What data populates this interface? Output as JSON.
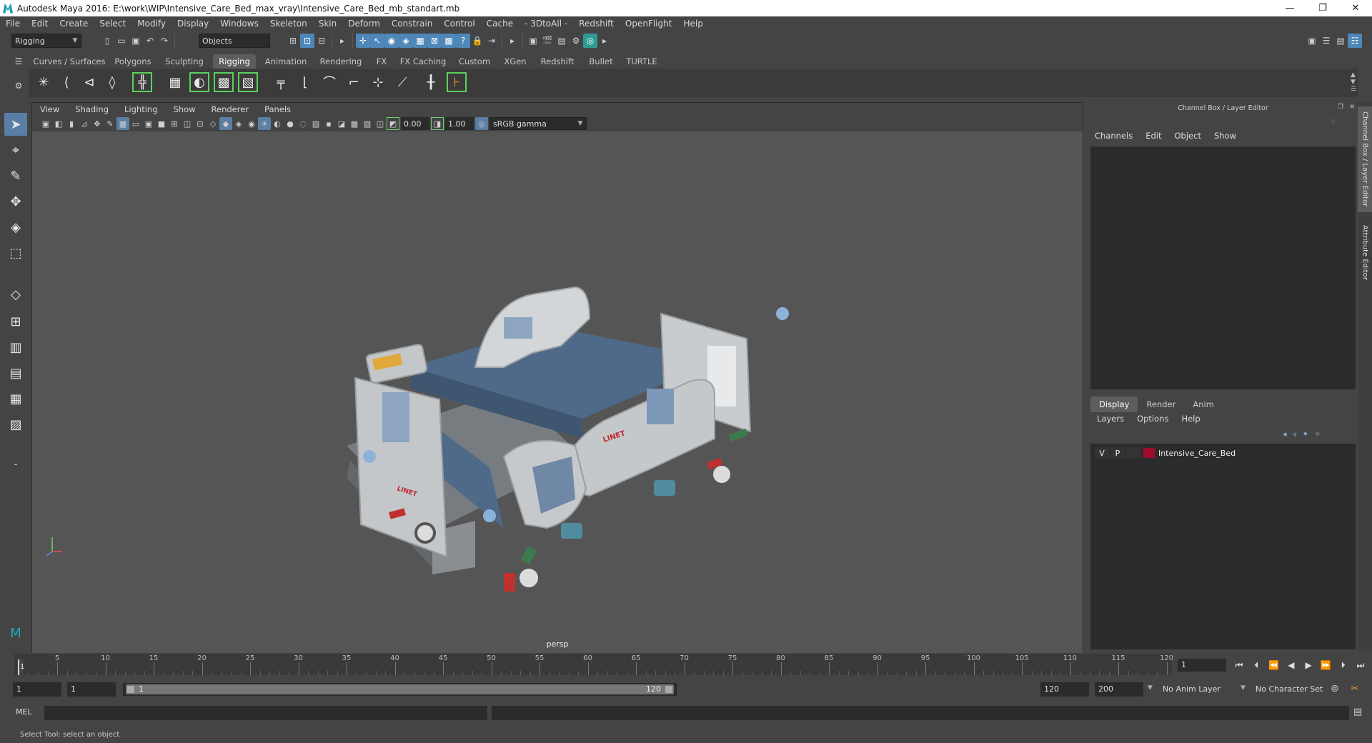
{
  "window": {
    "title": "Autodesk Maya 2016: E:\\work\\WIP\\Intensive_Care_Bed_max_vray\\Intensive_Care_Bed_mb_standart.mb",
    "minimize": "—",
    "restore": "❐",
    "close": "✕"
  },
  "menubar": {
    "items": [
      "File",
      "Edit",
      "Create",
      "Select",
      "Modify",
      "Display",
      "Windows",
      "Skeleton",
      "Skin",
      "Deform",
      "Constrain",
      "Control",
      "Cache",
      "- 3DtoAll -",
      "Redshift",
      "OpenFlight",
      "Help"
    ]
  },
  "statusline": {
    "menuset": "Rigging",
    "selection_mask": "Objects"
  },
  "shelf": {
    "tabs": [
      "Curves / Surfaces",
      "Polygons",
      "Sculpting",
      "Rigging",
      "Animation",
      "Rendering",
      "FX",
      "FX Caching",
      "Custom",
      "XGen",
      "Redshift",
      "Bullet",
      "TURTLE"
    ],
    "active_tab": "Rigging",
    "icons": [
      "joint-tool-icon",
      "ik-handle-icon",
      "ik-spline-icon",
      "insert-joint-icon",
      "mirror-joint-icon",
      "bind-skin-icon",
      "smooth-bind-icon",
      "lattice-icon",
      "cluster-icon",
      "point-constraint-icon",
      "aim-constraint-icon",
      "orient-constraint-icon",
      "scale-constraint-icon",
      "parent-constraint-icon",
      "pole-vector-icon",
      "locator-icon",
      "set-key-icon"
    ]
  },
  "viewport": {
    "menu": [
      "View",
      "Shading",
      "Lighting",
      "Show",
      "Renderer",
      "Panels"
    ],
    "exposure": "0.00",
    "gamma": "1.00",
    "color_space": "sRGB gamma",
    "camera_label": "persp",
    "brand_text": "LINET"
  },
  "channelbox": {
    "title": "Channel Box / Layer Editor",
    "menu": [
      "Channels",
      "Edit",
      "Object",
      "Show"
    ],
    "layer_tabs": [
      "Display",
      "Render",
      "Anim"
    ],
    "active_layer_tab": "Display",
    "layer_menu": [
      "Layers",
      "Options",
      "Help"
    ],
    "layers": [
      {
        "visible": "V",
        "playback": "P",
        "name": "Intensive_Care_Bed",
        "color": "#a00b2d"
      }
    ]
  },
  "sidetabs": [
    "Channel Box / Layer Editor",
    "Attribute Editor"
  ],
  "timeslider": {
    "tick_labels": [
      "5",
      "10",
      "15",
      "20",
      "25",
      "30",
      "35",
      "40",
      "45",
      "50",
      "55",
      "60",
      "65",
      "70",
      "75",
      "80",
      "85",
      "90",
      "95",
      "100",
      "105",
      "110",
      "115",
      "120"
    ],
    "current_frame_marker": "1",
    "current_frame": "1"
  },
  "range": {
    "start_time": "1",
    "playback_start": "1",
    "range_start_label": "1",
    "range_end_label": "120",
    "playback_end": "120",
    "end_time": "200",
    "anim_layer": "No Anim Layer",
    "character_set": "No Character Set"
  },
  "commandline": {
    "label": "MEL"
  },
  "helpline": {
    "text": "Select Tool: select an object"
  }
}
